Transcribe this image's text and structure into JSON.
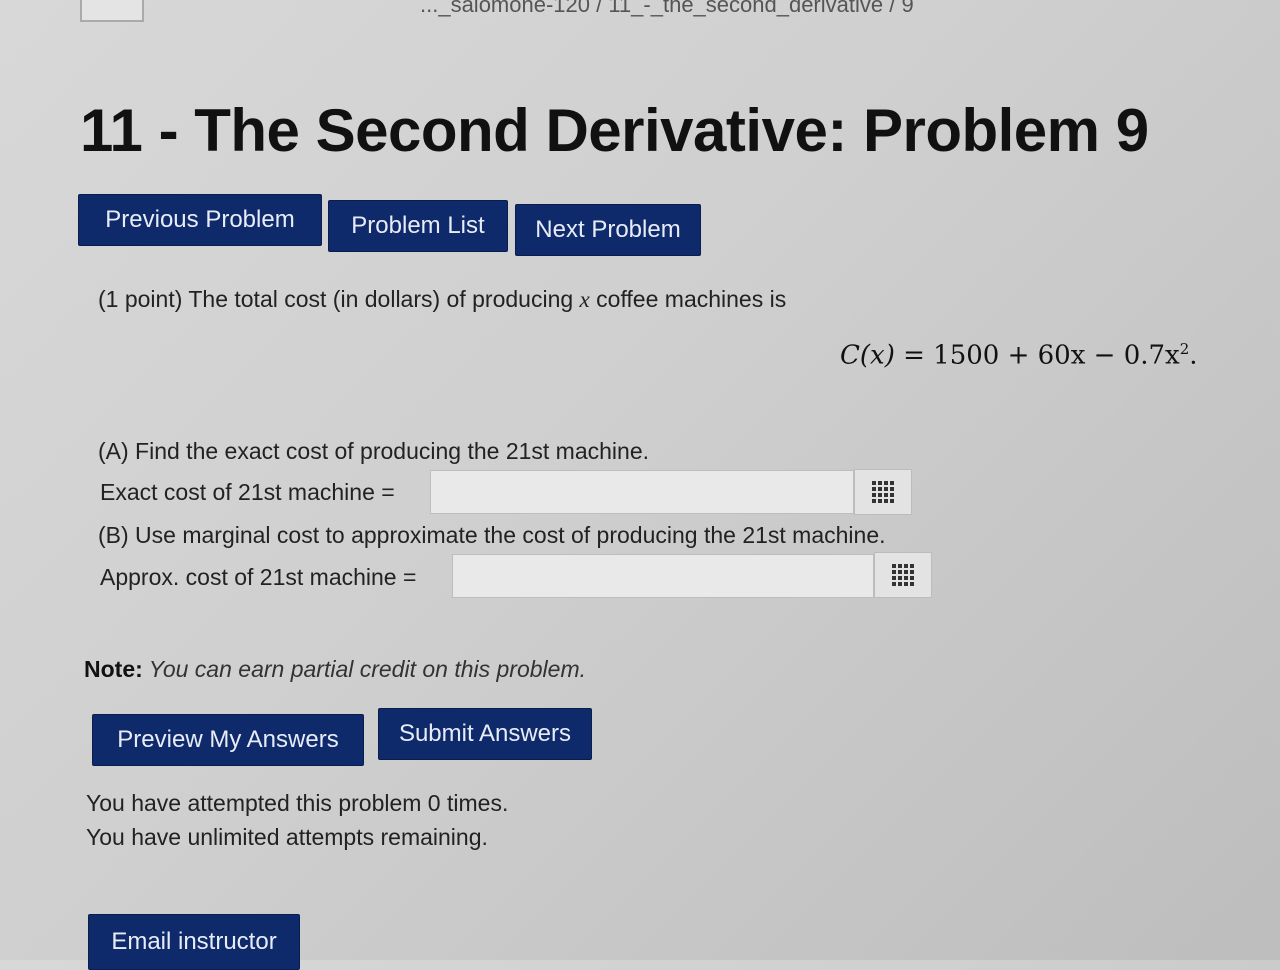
{
  "breadcrumb": "..._salomone-120 / 11_-_the_second_derivative / 9",
  "page_title": "11 - The Second Derivative: Problem 9",
  "nav": {
    "previous": "Previous Problem",
    "list": "Problem List",
    "next": "Next Problem"
  },
  "problem": {
    "intro_before_var": "(1 point) The total cost (in dollars) of producing ",
    "variable": "x",
    "intro_after_var": " coffee machines is",
    "formula": {
      "lhs": "C(x)",
      "rhs_prefix": " = 1500 + 60x − 0.7x",
      "exponent": "2",
      "suffix": "."
    },
    "part_a_text": "(A) Find the exact cost of producing the 21st machine.",
    "part_a_label": "Exact cost of 21st machine =",
    "part_a_value": "",
    "part_b_text": "(B) Use marginal cost to approximate the cost of producing the 21st machine.",
    "part_b_label": "Approx. cost of 21st machine =",
    "part_b_value": ""
  },
  "note": {
    "label": "Note:",
    "text": " You can earn partial credit on this problem."
  },
  "actions": {
    "preview": "Preview My Answers",
    "submit": "Submit Answers"
  },
  "attempts": {
    "line1": "You have attempted this problem 0 times.",
    "line2": "You have unlimited attempts remaining."
  },
  "email_button": "Email instructor",
  "colors": {
    "button_bg": "#0f2a6b",
    "button_text": "#e8ecf7",
    "page_bg": "#d4d4d4"
  },
  "icons": {
    "equation_editor": "grid-icon"
  }
}
